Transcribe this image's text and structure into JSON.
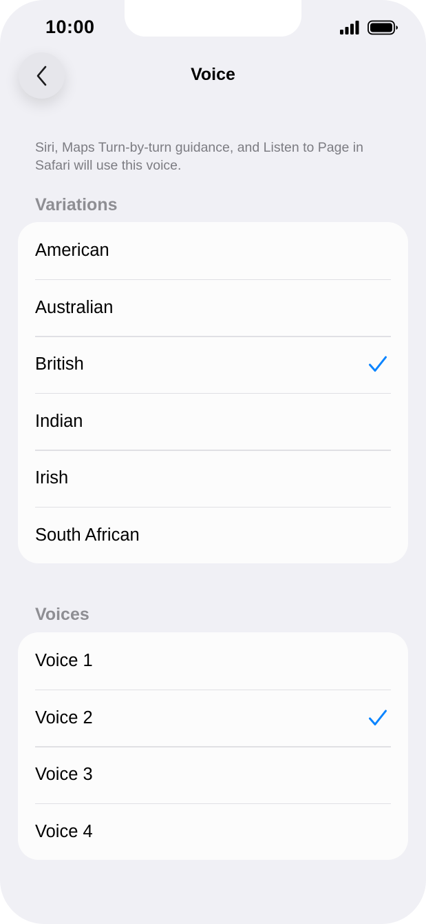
{
  "status_bar": {
    "time": "10:00",
    "icons": [
      "signal-icon",
      "battery-icon"
    ]
  },
  "nav": {
    "back_icon": "chevron-left-icon",
    "title": "Voice"
  },
  "description": "Siri, Maps Turn-by-turn guidance, and Listen to Page in Safari will use this voice.",
  "variations": {
    "header": "Variations",
    "items": [
      {
        "label": "American",
        "selected": false
      },
      {
        "label": "Australian",
        "selected": false
      },
      {
        "label": "British",
        "selected": true
      },
      {
        "label": "Indian",
        "selected": false
      },
      {
        "label": "Irish",
        "selected": false
      },
      {
        "label": "South African",
        "selected": false
      }
    ]
  },
  "voices": {
    "header": "Voices",
    "items": [
      {
        "label": "Voice 1",
        "selected": false
      },
      {
        "label": "Voice 2",
        "selected": true
      },
      {
        "label": "Voice 3",
        "selected": false
      },
      {
        "label": "Voice 4",
        "selected": false
      }
    ]
  },
  "colors": {
    "background": "#f0f0f5",
    "card": "#fcfcfc",
    "accent": "#0a84ff",
    "secondary_text": "#8e8e93"
  }
}
